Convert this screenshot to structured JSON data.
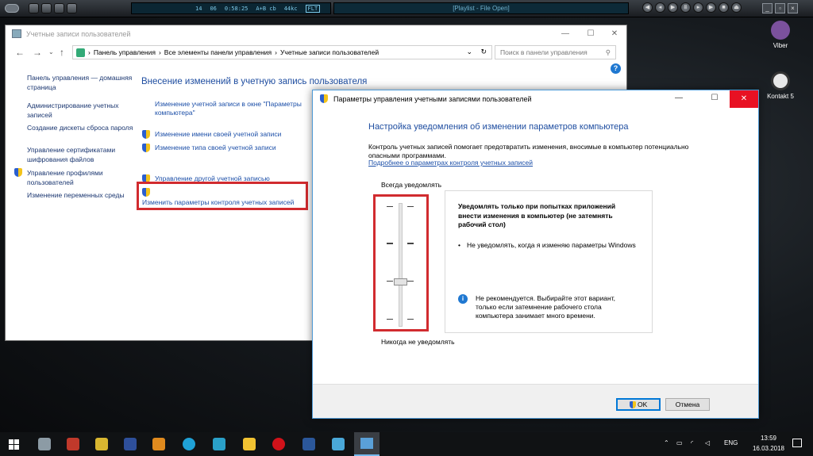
{
  "player": {
    "lcd_track": "14",
    "lcd_sub": "06",
    "lcd_time": "0:58:25",
    "lcd_ab": "A+B cb",
    "lcd_rate": "44kc",
    "lcd_box": "FLT",
    "title": "[Playlist - File Open]"
  },
  "desktop_icons": [
    {
      "label": "Viber",
      "color": "#7b519d"
    },
    {
      "label": "Kontakt 5",
      "color": "#e8e8e8"
    }
  ],
  "cp": {
    "window_title": "Учетные записи пользователей",
    "breadcrumb": [
      "Панель управления",
      "Все элементы панели управления",
      "Учетные записи пользователей"
    ],
    "search_placeholder": "Поиск в панели управления",
    "sidebar": [
      "Панель управления — домашняя страница",
      "Администрирование учетных записей",
      "Создание дискеты сброса пароля",
      "Управление сертификатами шифрования файлов",
      "Управление профилями пользователей",
      "Изменение переменных среды"
    ],
    "main_title": "Внесение изменений в учетную запись пользователя",
    "links": [
      "Изменение учетной записи в окне \"Параметры компьютера\"",
      "Изменение имени своей учетной записи",
      "Изменение типа своей учетной записи",
      "Управление другой учетной записью",
      "Изменить параметры контроля учетных записей"
    ]
  },
  "uac": {
    "window_title": "Параметры управления учетными записями пользователей",
    "heading": "Настройка уведомления об изменении параметров компьютера",
    "description": "Контроль учетных записей помогает предотвратить изменения, вносимые в компьютер потенциально опасными программами.",
    "learn_more": "Подробнее о параметрах контроля учетных записей",
    "always_label": "Всегда уведомлять",
    "never_label": "Никогда не уведомлять",
    "slider_level": 2,
    "slider_levels": 4,
    "panel_title": "Уведомлять только при попытках приложений внести изменения в компьютер (не затемнять рабочий стол)",
    "panel_bullet": "Не уведомлять, когда я изменяю параметры Windows",
    "panel_info": "Не рекомендуется. Выбирайте этот вариант, только если затемнение рабочего стола компьютера занимает много времени.",
    "ok_label": "OK",
    "cancel_label": "Отмена"
  },
  "tray": {
    "lang": "ENG",
    "time": "13:59",
    "date": "16.03.2018"
  },
  "colors": {
    "accent": "#1e4da0",
    "highlight": "#d12b2f",
    "close": "#e81123"
  }
}
